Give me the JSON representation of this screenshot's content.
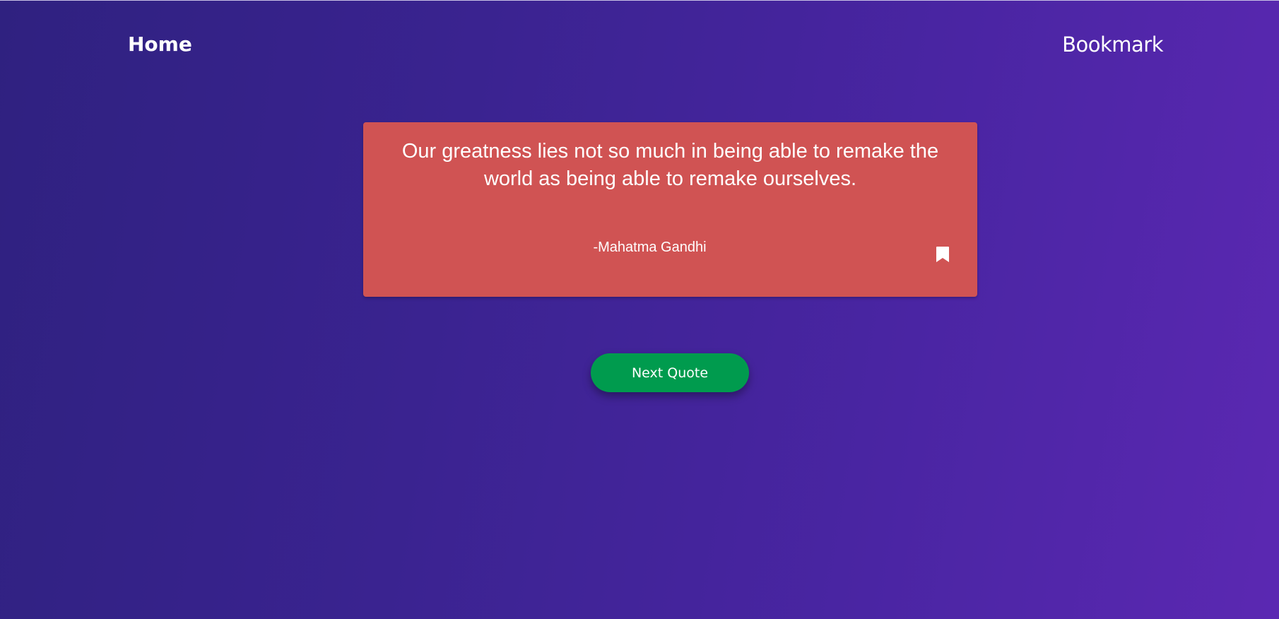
{
  "nav": {
    "home_label": "Home",
    "bookmark_label": "Bookmark"
  },
  "quote": {
    "text": "Our greatness lies not so much in being able to remake the world as being able to remake ourselves.",
    "author": "-Mahatma Gandhi",
    "bookmark_icon": "bookmark-icon"
  },
  "actions": {
    "next_label": "Next Quote"
  },
  "colors": {
    "background_start": "#2f2180",
    "background_end": "#5b28b2",
    "card": "#d05353",
    "button": "#009b4e",
    "text": "#ffffff"
  }
}
